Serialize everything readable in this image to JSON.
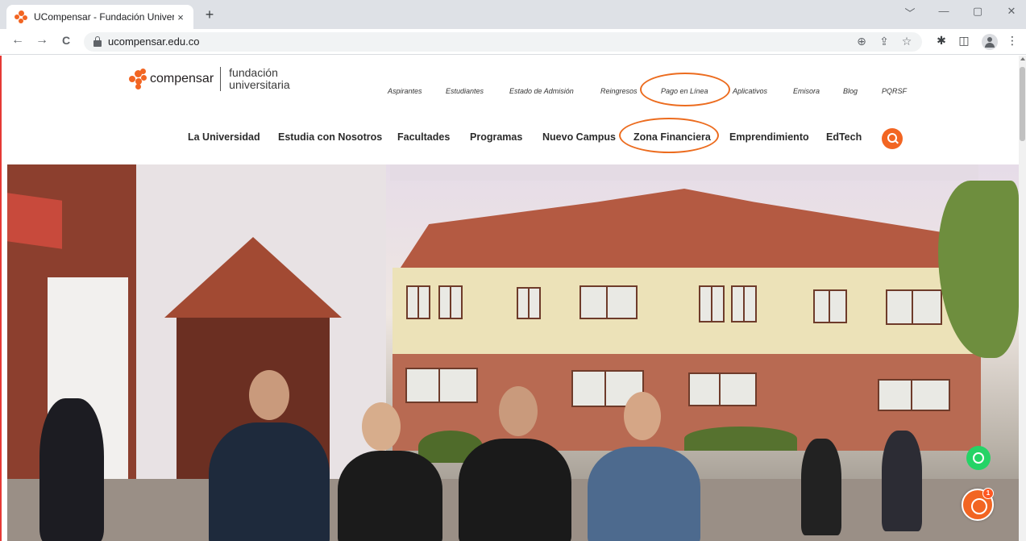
{
  "browser": {
    "tab_title": "UCompensar - Fundación Univer",
    "tab_close": "×",
    "new_tab": "+",
    "url": "ucompensar.edu.co",
    "nav_icons": {
      "back": "←",
      "forward": "→",
      "reload": "C"
    },
    "window_controls": {
      "chevron": "﹀",
      "minimize": "—",
      "restore": "▢",
      "close": "✕"
    },
    "toolbar_icons": {
      "zoom": "⊕",
      "share": "⇪",
      "bookmark": "☆",
      "extensions": "✱",
      "sidebar": "◫",
      "menu": "⋮"
    }
  },
  "site": {
    "logo": {
      "brand": "compensar",
      "sub_line1": "fundación",
      "sub_line2": "universitaria",
      "color": "#f26522"
    },
    "top_nav": [
      {
        "label": "Aspirantes"
      },
      {
        "label": "Estudiantes"
      },
      {
        "label": "Estado de Admisión"
      },
      {
        "label": "Reingresos"
      },
      {
        "label": "Pago en Línea",
        "highlighted": true
      },
      {
        "label": "Aplicativos"
      },
      {
        "label": "Emisora"
      },
      {
        "label": "Blog"
      },
      {
        "label": "PQRSF"
      }
    ],
    "main_nav": [
      {
        "label": "La Universidad"
      },
      {
        "label": "Estudia con Nosotros"
      },
      {
        "label": "Facultades"
      },
      {
        "label": "Programas"
      },
      {
        "label": "Nuevo Campus"
      },
      {
        "label": "Zona Financiera",
        "highlighted": true
      },
      {
        "label": "Emprendimiento"
      },
      {
        "label": "EdTech"
      }
    ],
    "highlight_color": "#ec6c1f",
    "chat_badge": "1"
  }
}
